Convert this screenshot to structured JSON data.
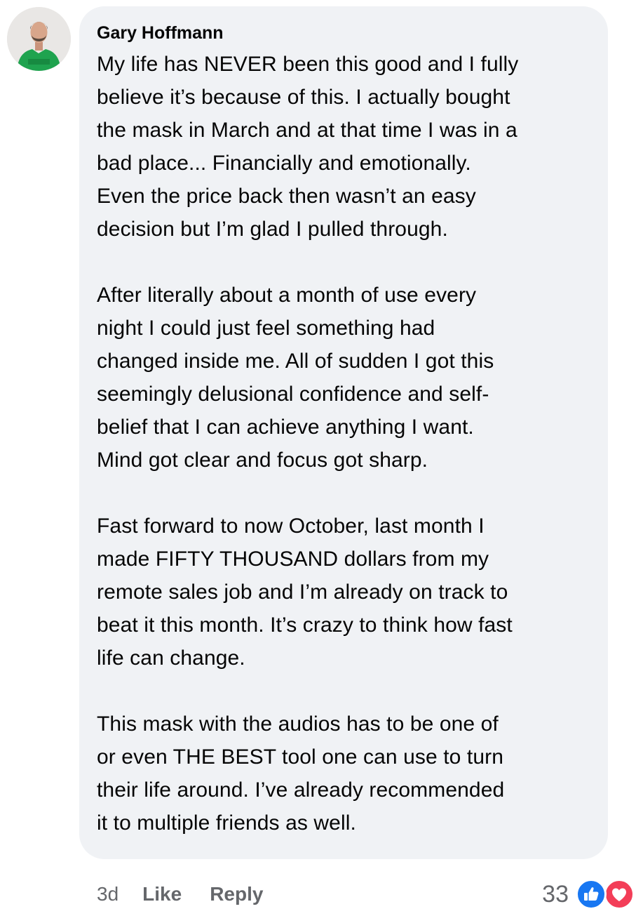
{
  "comment": {
    "author": "Gary Hoffmann",
    "paragraphs": [
      [
        "My life has NEVER been this good and I fully",
        "believe it’s because of this. I actually bought",
        "the mask in March and at that time I was in a",
        "bad place... Financially and emotionally.",
        "Even the price back then wasn’t an easy",
        "decision but I’m glad I pulled through."
      ],
      [
        "After literally about a month of use every",
        "night I could just feel something had",
        "changed inside me. All of sudden I got this",
        "seemingly delusional confidence and self-",
        "belief that I can achieve anything I want.",
        "Mind got clear and focus got sharp."
      ],
      [
        "Fast forward to now October, last month I",
        "made FIFTY THOUSAND dollars from my",
        "remote sales job and I’m already on track to",
        "beat it this month. It’s crazy to think how fast",
        "life can change."
      ],
      [
        "This mask with the audios has to be one of",
        "or even THE BEST tool one can use to turn",
        "their life around. I’ve already recommended",
        "it to multiple friends as well."
      ]
    ]
  },
  "actions": {
    "time": "3d",
    "like": "Like",
    "reply": "Reply"
  },
  "reactions": {
    "count": "33",
    "icons": [
      "like-icon",
      "love-icon"
    ],
    "colors": {
      "like": "#1877f2",
      "love": "#f33e58"
    }
  }
}
